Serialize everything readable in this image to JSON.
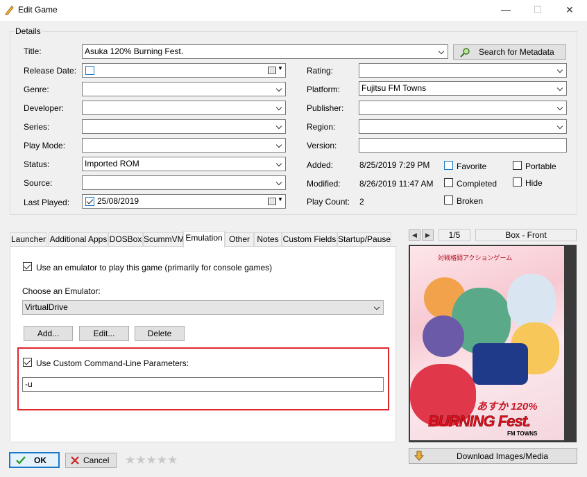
{
  "window": {
    "title": "Edit Game",
    "minimize": "—",
    "maximize": "☐",
    "close": "✕"
  },
  "details": {
    "group_title": "Details",
    "title_label": "Title:",
    "title_value": "Asuka 120% Burning Fest.",
    "search_metadata": "Search for Metadata",
    "release_date_label": "Release Date:",
    "genre_label": "Genre:",
    "developer_label": "Developer:",
    "series_label": "Series:",
    "play_mode_label": "Play Mode:",
    "status_label": "Status:",
    "status_value": "Imported ROM",
    "source_label": "Source:",
    "last_played_label": "Last Played:",
    "last_played_value": "25/08/2019",
    "rating_label": "Rating:",
    "platform_label": "Platform:",
    "platform_value": "Fujitsu FM Towns",
    "publisher_label": "Publisher:",
    "region_label": "Region:",
    "version_label": "Version:",
    "added_label": "Added:",
    "added_value": "8/25/2019 7:29 PM",
    "modified_label": "Modified:",
    "modified_value": "8/26/2019 11:47 AM",
    "play_count_label": "Play Count:",
    "play_count_value": "2",
    "favorite": "Favorite",
    "completed": "Completed",
    "broken": "Broken",
    "portable": "Portable",
    "hide": "Hide"
  },
  "tabs": [
    "Launcher",
    "Additional Apps",
    "DOSBox",
    "ScummVM",
    "Emulation",
    "Other",
    "Notes",
    "Custom Fields",
    "Startup/Pause"
  ],
  "emulation": {
    "use_emulator": "Use an emulator to play this game (primarily for console games)",
    "choose_label": "Choose an Emulator:",
    "emulator_value": "VirtualDrive",
    "add": "Add...",
    "edit": "Edit...",
    "delete": "Delete",
    "use_custom": "Use Custom Command-Line Parameters:",
    "params_value": "-u"
  },
  "image_panel": {
    "prev": "◀",
    "next": "▶",
    "counter": "1/5",
    "image_type": "Box - Front",
    "download": "Download Images/Media",
    "cover_top_text": "対戦格闘アクションゲーム",
    "cover_title_jp": "あすか 120%",
    "cover_title_en": "BURNING Fest.",
    "cover_platform": "FM TOWNS"
  },
  "footer": {
    "ok": "OK",
    "cancel": "Cancel",
    "rating_stars": 0
  },
  "colors": {
    "highlight": "#e0242b",
    "accent_blue": "#1979ca"
  }
}
